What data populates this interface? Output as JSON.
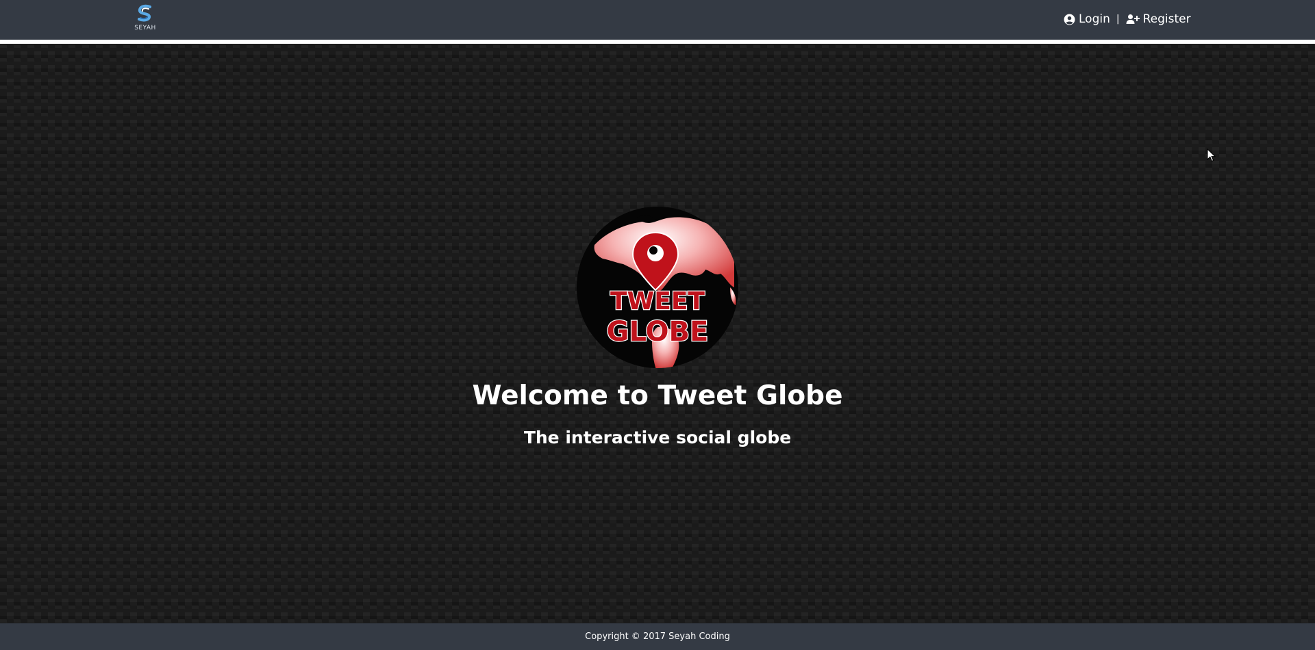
{
  "header": {
    "brand": {
      "icon": "seyah-logo-icon",
      "text": "SEYAH"
    },
    "auth": {
      "login_label": "Login",
      "login_icon": "user-circle-icon",
      "separator": "|",
      "register_label": "Register",
      "register_icon": "user-plus-icon"
    }
  },
  "hero": {
    "logo": {
      "icon": "tweet-globe-logo",
      "line1": "TWEET",
      "line2": "GLOBE"
    },
    "title": "Welcome to Tweet Globe",
    "subtitle": "The interactive social globe"
  },
  "footer": {
    "copyright": "Copyright © 2017 Seyah Coding"
  },
  "colors": {
    "bar_bg": "#343a44",
    "header_border": "#ffffff",
    "logo_red": "#c0121b",
    "logo_pink": "#f29a9a",
    "text": "#ffffff"
  }
}
